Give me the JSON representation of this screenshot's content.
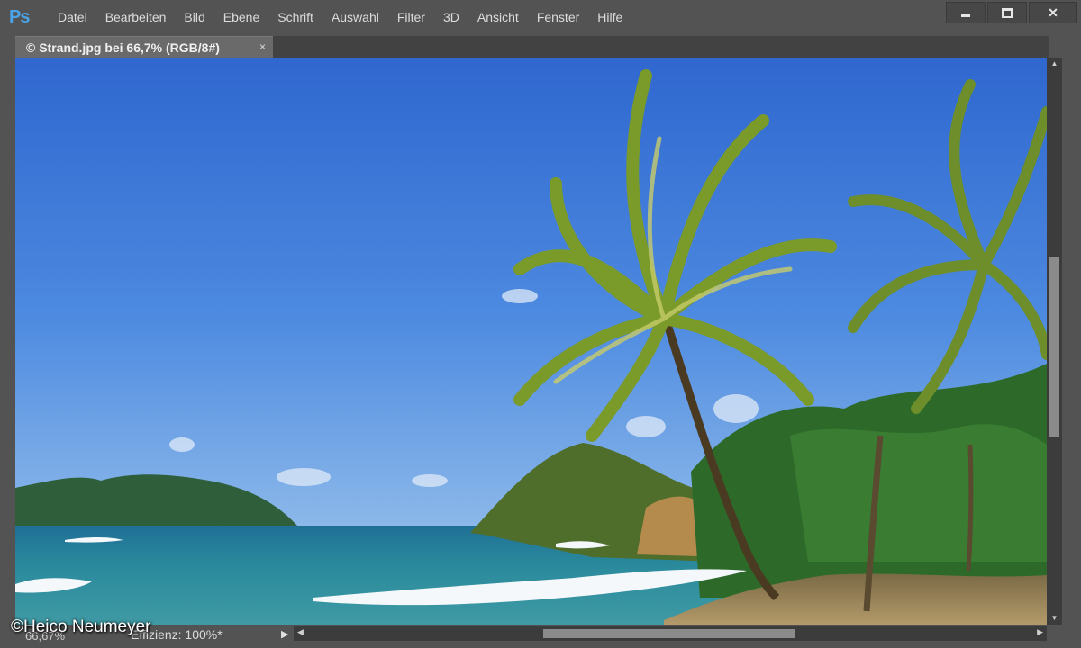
{
  "app": {
    "logo": "Ps"
  },
  "menu": [
    "Datei",
    "Bearbeiten",
    "Bild",
    "Ebene",
    "Schrift",
    "Auswahl",
    "Filter",
    "3D",
    "Ansicht",
    "Fenster",
    "Hilfe"
  ],
  "window_controls": {
    "close_glyph": "✕"
  },
  "document_tab": {
    "title": "© Strand.jpg bei 66,7% (RGB/8#)",
    "close_glyph": "×"
  },
  "status": {
    "zoom": "66,67%",
    "info": "Effizienz: 100%*",
    "menu_arrow": "▶"
  },
  "scroll": {
    "up": "▲",
    "down": "▼",
    "left": "◀",
    "right": "▶"
  },
  "watermark": "©Heico Neumeyer",
  "colors": {
    "sky_top": "#2f67cf",
    "sky_bottom": "#7fb0e8",
    "sea": "#2a8a9c",
    "foliage": "#2f6b2a"
  }
}
